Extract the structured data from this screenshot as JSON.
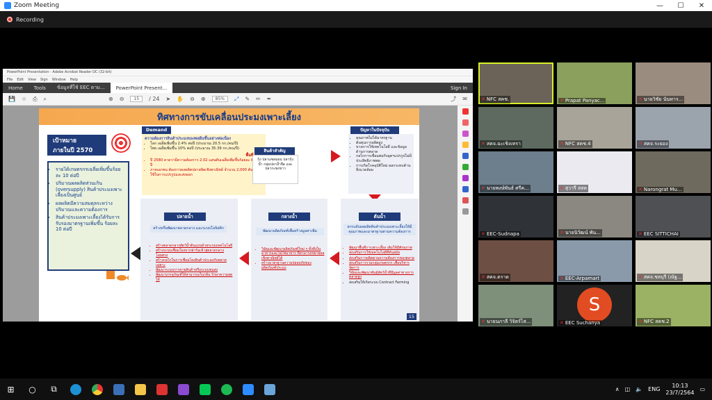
{
  "window": {
    "title": "Zoom Meeting",
    "recording": "Recording"
  },
  "acrobat": {
    "title": "PowerPoint Presentation - Adobe Acrobat Reader DC (32-bit)",
    "menu": [
      "File",
      "Edit",
      "View",
      "Sign",
      "Window",
      "Help"
    ],
    "tabs": [
      "Home",
      "Tools",
      "ข้อมูลที่ใช้ EEC ตาม...",
      "PowerPoint Present..."
    ],
    "signin": "Sign In",
    "page": "15",
    "pages": "/ 24",
    "zoom": "85%"
  },
  "slide": {
    "title": "ทิศทางการขับเคลื่อนประมงเพาะเลี้ยง",
    "goal_line1": "เป้าหมาย",
    "goal_line2": "ภายในปี 2570",
    "goals": [
      "รายได้เกษตรกรเฉลี่ยเพิ่มขึ้นร้อยละ 10 ต่อปี",
      "ปริมาณผลผลิตส่วนเกิน (oversupply) สินค้าประมงเพาะเลี้ยงเป็นศูนย์",
      "ผลผลิตมีความสมดุลระหว่างปริมาณและความต้องการ",
      "สินค้าประมงเพาะเลี้ยงได้รับการรับรองมาตรฐานเพิ่มขึ้น ร้อยละ 10 ต่อปี"
    ],
    "demand_label": "Demand",
    "demand_head": "ความต้องการสินค้าประมงของพ่อผืนขึ้นอย่างต่อเนื่อง",
    "demand_items": [
      "โลก เฉลี่ยเพิ่มขึ้น 2.4% ต่อปี (ประมาณ 20.5 กก./คน/ปี)",
      "ไทย เฉลี่ยเพิ่มขึ้น 10% ต่อปี (ประมาณ 35.39 กก./คน/ปี)"
    ],
    "eec_label": "พื้นที่ EEC",
    "eec_items": [
      "ปี 2580 คาดว่ามีความต้องการ 2.02 แสนตันเฉลี่ยเพิ่มขึ้นร้อยละ 8.4 ต่อปี",
      "ภาคเอกชน ต้องการผลผลิตปลาสลิดเชิงพาณิชย์ จำนวน 2,000 ตัน เพื่อใช้ในการแปรรูปและส่งออก"
    ],
    "product_label": "สินค้าสำคัญ",
    "product_text": "กุ้ง ปลาแซลมอน ปลากุ้ง น้ำ กลุ่มปลาน้ำจืด และปลากะพงขาว",
    "problem_label": "ปัญหาในปัจจุบัน",
    "problems": [
      "คุณภาพไม่ได้มาตรฐาน",
      "ต้นทุนการผลิตสูง",
      "ขาดการใช้เทคโนโลยี และข้อมูลด้านการตลาด",
      "กลไกการเชื่อมต่อกับอุตฯแปรรูปไม่มีประสิทธิภาพพอ",
      "การเกิดโรคอุบัติใหม่ ผลกระทบด้านสิ่งแวดล้อม"
    ],
    "upstream": {
      "label": "ต้นน้ำ",
      "sub": "ยกระดับผลผลิตสินค้าประมงเพาะเลี้ยงให้มีคุณภาพและมาตรฐานตามความต้องการ",
      "items": [
        "พัฒนาพื้นที่การเพาะเลี้ยง เติมให้มีศักยภาพ",
        "ส่งเสริมการใช้เทคโนโลยีที่ทันสมัย",
        "ส่งเสริมการผลิตตามความต้องการของตลาด",
        "ส่งเสริมการรวมกลุ่มเกษตรกร เพื่อบริหารจัดการ",
        "วิจัยและพัฒนาพันธุ์สัตว์น้ำที่มีมูลค่าทางการตลาดสูง",
        "ส่งเสริมให้เกิดระบบ Contract Farming"
      ]
    },
    "midstream": {
      "label": "กลางน้ำ",
      "sub": "พัฒนาผลิตภัณฑ์เพื่อสร้างมูลค่าเพิ่ม",
      "items": [
        "วิจัยและพัฒนาผลิตภัณฑ์ใหม่ ๆ ทั้งที่เป็นอาหารและไม่ใช่อาหาร ที่สามารถขยายผลเชิงพาณิชย์ได้",
        "สร้างมาตรฐานความปลอดภัยของผลิตภัณฑ์ประมง"
      ]
    },
    "downstream": {
      "label": "ปลายน้ำ",
      "sub": "สร้างหรือพัฒนาตลาดกลาง และระบบโลจิสติก",
      "items": [
        "สร้างตลาดกลางสัตว์น้ำต้นแบบด้วยระบบเทคโนโลยี",
        "สร้างระบบเชื่อมโยงจากฟาร์มเข้าสู่ตลาดกลางโดยตรง",
        "สร้างกลไกในการเชื่อมโยงสินค้าประมงกับตลาดเฉพาะ",
        "พัฒนาระบบการขายสินค้าหรือระบบขนส่ง",
        "พัฒนาบรรจุภัณฑ์ให้สามารถเก็บกลิ่น รักษาความสดได้"
      ]
    },
    "page_num": "15"
  },
  "participants": [
    {
      "name": "NFC สคช.",
      "bg": "#6b6357",
      "active": true
    },
    {
      "name": "Prapat Panyac...",
      "bg": "#8ca05e"
    },
    {
      "name": "นายวิชัย นันทาร...",
      "bg": "#9a8d80"
    },
    {
      "name": "สคจ.ฉะเชิงเทรา",
      "bg": "#5e6a60"
    },
    {
      "name": "NFC สคช.4",
      "bg": "#a8a49a"
    },
    {
      "name": "สคจ.ระยอง",
      "bg": "#9ba3ad"
    },
    {
      "name": "นายพงษ์พันธ์ ศรีค...",
      "bg": "#6d7e8c"
    },
    {
      "name": "สุวารี สสต",
      "bg": "#eaeaf0"
    },
    {
      "name": "Narongrat Mu...",
      "bg": "#6f6a5e"
    },
    {
      "name": "EEC-Sudnapa",
      "bg": "#2f3236"
    },
    {
      "name": "นายนิวัฒน์ พัน...",
      "bg": "#8a8880"
    },
    {
      "name": "EEC SITTICHAI",
      "bg": "#4e5054"
    },
    {
      "name": "สคจ.ตราด",
      "bg": "#6d4f44"
    },
    {
      "name": "EEC-Arpamart",
      "bg": "#8a9aaa"
    },
    {
      "name": "สคจ.ชลบุรี (ณัฐ...",
      "bg": "#d8d4c8"
    },
    {
      "name": "นายนภาลี วิจิตร์ไส...",
      "bg": "#7e8f7a"
    },
    {
      "name": "EEC Suchanya",
      "bg": "#222222",
      "avatar": "S"
    },
    {
      "name": "NFC สคช.2",
      "bg": "#9bb264"
    }
  ],
  "taskbar": {
    "lang": "ENG",
    "time": "10:13",
    "date": "23/7/2564"
  }
}
